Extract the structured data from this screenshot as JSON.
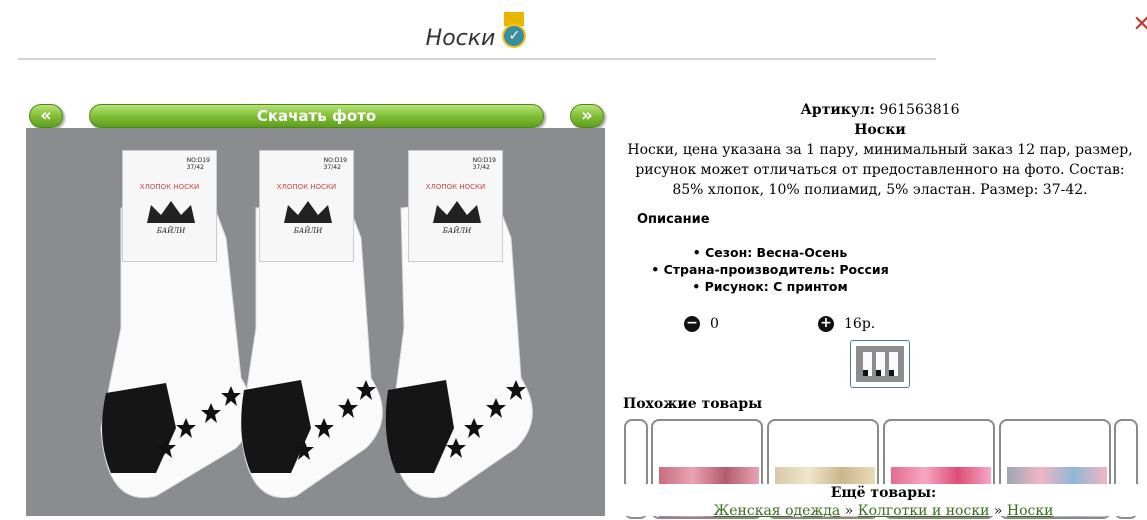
{
  "header": {
    "title": "Носки",
    "badge_icon": "verified-check-icon",
    "close_icon": "close-icon"
  },
  "gallery": {
    "prev_label": "«",
    "download_label": "Скачать фото",
    "next_label": "»",
    "photo_tags": {
      "model": "NO:D19",
      "size": "37/42",
      "material_text": "ХЛОПОК НОСКИ",
      "brand": "БАЙЛИ"
    }
  },
  "product": {
    "article_label": "Артикул:",
    "article_value": "961563816",
    "name": "Носки",
    "description": "Носки, цена указана за 1 пару, минимальный заказ 12 пар, размер, рисунок может отличаться от предоставленного на фото. Состав: 85% хлопок, 10% полиамид, 5% эластан. Размер: 37-42.",
    "description_heading": "Описание",
    "features": [
      "Сезон: Весна-Осень",
      "Страна-производитель: Россия",
      "Рисунок: С принтом"
    ],
    "quantity": "0",
    "price": "16р."
  },
  "similar": {
    "heading": "Похожие товары"
  },
  "more": {
    "heading": "Ещё товары:",
    "crumbs": [
      "Женская одежда",
      "Колготки и носки",
      "Носки"
    ],
    "separator": "»"
  },
  "colors": {
    "accent_green": "#86c23a",
    "link_green": "#3b6e1a",
    "photo_bg": "#8a8c90"
  }
}
